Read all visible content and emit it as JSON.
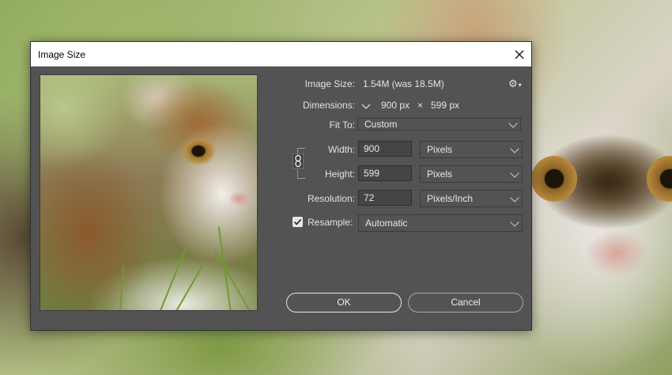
{
  "dialog": {
    "title": "Image Size"
  },
  "image_size": {
    "label": "Image Size:",
    "value": "1.54M (was 18.5M)"
  },
  "dimensions": {
    "label": "Dimensions:",
    "width": "900 px",
    "times": "×",
    "height": "599 px"
  },
  "fit_to": {
    "label": "Fit To:",
    "value": "Custom"
  },
  "width": {
    "label": "Width:",
    "value": "900",
    "unit": "Pixels"
  },
  "height": {
    "label": "Height:",
    "value": "599",
    "unit": "Pixels"
  },
  "resolution": {
    "label": "Resolution:",
    "value": "72",
    "unit": "Pixels/Inch"
  },
  "resample": {
    "label": "Resample:",
    "checked": true,
    "value": "Automatic"
  },
  "buttons": {
    "ok": "OK",
    "cancel": "Cancel"
  },
  "icons": {
    "close": "close-icon",
    "settings": "gear-icon",
    "link": "chain-link-icon",
    "checkbox": "checkmark-icon",
    "dimensions_dropdown": "chevron-down-icon"
  },
  "colors": {
    "dialog_bg": "#535353",
    "field_bg": "#454545",
    "text": "#e4e4e4"
  }
}
